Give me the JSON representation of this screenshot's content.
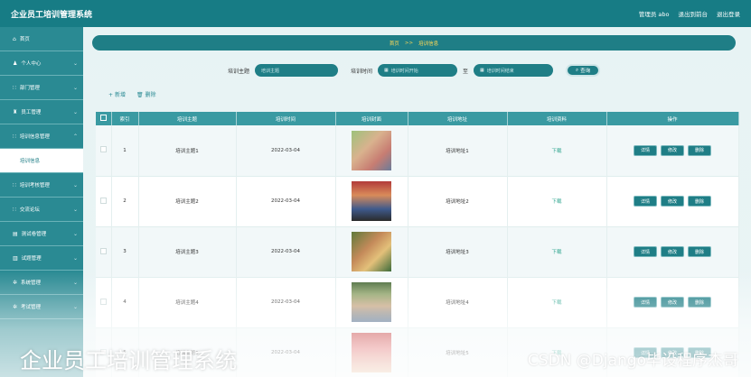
{
  "app": {
    "title": "企业员工培训管理系统",
    "user_label": "管理员 abo",
    "back_label": "退出到前台",
    "logout_label": "退出登录"
  },
  "sidebar": {
    "items": [
      {
        "label": "首页",
        "icon": "home-icon",
        "glyph": "⌂"
      },
      {
        "label": "个人中心",
        "icon": "user-icon",
        "glyph": "♟"
      },
      {
        "label": "部门管理",
        "icon": "grid-icon",
        "glyph": "∷"
      },
      {
        "label": "员工管理",
        "icon": "staff-icon",
        "glyph": "♜"
      },
      {
        "label": "培训信息管理",
        "icon": "grid-icon",
        "glyph": "∷"
      },
      {
        "label": "培训信息",
        "icon": "",
        "glyph": "",
        "active": true
      },
      {
        "label": "培训考核管理",
        "icon": "grid-icon",
        "glyph": "∷"
      },
      {
        "label": "交流论坛",
        "icon": "grid-icon",
        "glyph": "∷"
      },
      {
        "label": "测试卷管理",
        "icon": "paper-icon",
        "glyph": "▤"
      },
      {
        "label": "试题管理",
        "icon": "chart-icon",
        "glyph": "▥"
      },
      {
        "label": "系统管理",
        "icon": "settings-icon",
        "glyph": "✲"
      },
      {
        "label": "考试管理",
        "icon": "exam-icon",
        "glyph": "✲"
      }
    ]
  },
  "breadcrumb": {
    "home": "首页",
    "sep": ">>",
    "current": "培训信息"
  },
  "search": {
    "topic_label": "培训主题",
    "topic_placeholder": "培训主题",
    "time_label": "培训时间",
    "start_placeholder": "培训时间开始",
    "range_sep": "至",
    "end_placeholder": "培训时间结束",
    "button_label": "查询"
  },
  "actions": {
    "add_label": "新增",
    "delete_label": "删除"
  },
  "table": {
    "headers": [
      "索引",
      "培训主题",
      "培训时间",
      "培训封面",
      "培训地址",
      "培训资料",
      "操作"
    ],
    "rows": [
      {
        "index": "1",
        "topic": "培训主题1",
        "time": "2022-03-04",
        "address": "培训地址1",
        "material": "下载"
      },
      {
        "index": "2",
        "topic": "培训主题2",
        "time": "2022-03-04",
        "address": "培训地址2",
        "material": "下载"
      },
      {
        "index": "3",
        "topic": "培训主题3",
        "time": "2022-03-04",
        "address": "培训地址3",
        "material": "下载"
      },
      {
        "index": "4",
        "topic": "培训主题4",
        "time": "2022-03-04",
        "address": "培训地址4",
        "material": "下载"
      },
      {
        "index": "5",
        "topic": "培训主题5",
        "time": "2022-03-04",
        "address": "培训地址5",
        "material": "下载"
      }
    ],
    "op_detail": "详情",
    "op_edit": "修改",
    "op_delete": "删除"
  },
  "overlay": {
    "title": "企业员工培训管理系统",
    "watermark": "CSDN @Django毕设程序杰哥"
  }
}
